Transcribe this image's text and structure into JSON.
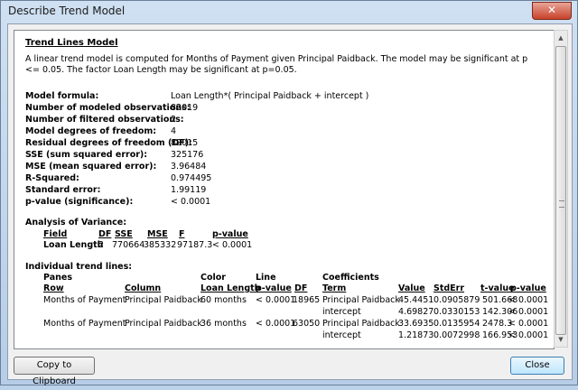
{
  "window": {
    "title": "Describe Trend Model",
    "close_glyph": "✕"
  },
  "report": {
    "heading": "Trend Lines Model",
    "intro": "A linear trend model is computed for Months of Payment given Principal Paidback.  The model may be significant at p <= 0.05.  The factor Loan Length may be significant at p=0.05.",
    "stats": [
      {
        "label": "Model formula:",
        "value": "Loan Length*( Principal Paidback + intercept )"
      },
      {
        "label": "Number of modeled observations:",
        "value": "82019"
      },
      {
        "label": "Number of filtered observations:",
        "value": "2"
      },
      {
        "label": "Model degrees of freedom:",
        "value": "4"
      },
      {
        "label": "Residual degrees of freedom (DF):",
        "value": "82015"
      },
      {
        "label": "SSE (sum squared error):",
        "value": "325176"
      },
      {
        "label": "MSE (mean squared error):",
        "value": "3.96484"
      },
      {
        "label": "R-Squared:",
        "value": "0.974495"
      },
      {
        "label": "Standard error:",
        "value": "1.99119"
      },
      {
        "label": "p-value (significance):",
        "value": "< 0.0001"
      }
    ],
    "anova": {
      "heading": "Analysis of Variance:",
      "headers": {
        "field": "Field",
        "df": "DF",
        "sse": "SSE",
        "mse": "MSE",
        "f": "F",
        "p": "p-value"
      },
      "row": {
        "field": "Loan Length",
        "df": "2",
        "sse": "770664",
        "mse": "385332",
        "f": "97187.3",
        "p": "< 0.0001"
      }
    },
    "trend": {
      "heading": "Individual trend lines:",
      "group_headers": {
        "panes": "Panes",
        "color": "Color",
        "line": "Line",
        "coefficients": "Coefficients"
      },
      "headers": {
        "row": "Row",
        "column": "Column",
        "color": "Loan Length",
        "pvalue": "p-value",
        "df": "DF",
        "term": "Term",
        "value": "Value",
        "stderr": "StdErr",
        "tvalue": "t-value",
        "pvalue2": "p-value"
      },
      "rows": [
        {
          "row": "Months of Payment",
          "column": "Principal Paidback",
          "color": "60 months",
          "pvalue": "< 0.0001",
          "df": "18965",
          "terms": [
            {
              "term": "Principal Paidback",
              "value": "45.4451",
              "stderr": "0.0905879",
              "tvalue": "501.668",
              "pvalue": "< 0.0001"
            },
            {
              "term": "intercept",
              "value": "4.69827",
              "stderr": "0.0330153",
              "tvalue": "142.306",
              "pvalue": "< 0.0001"
            }
          ]
        },
        {
          "row": "Months of Payment",
          "column": "Principal Paidback",
          "color": "36 months",
          "pvalue": "< 0.0001",
          "df": "63050",
          "terms": [
            {
              "term": "Principal Paidback",
              "value": "33.6935",
              "stderr": "0.0135954",
              "tvalue": "2478.3",
              "pvalue": "< 0.0001"
            },
            {
              "term": "intercept",
              "value": "1.21873",
              "stderr": "0.0072998",
              "tvalue": "166.953",
              "pvalue": "< 0.0001"
            }
          ]
        }
      ]
    }
  },
  "buttons": {
    "copy": "Copy to Clipboard",
    "close": "Close"
  }
}
